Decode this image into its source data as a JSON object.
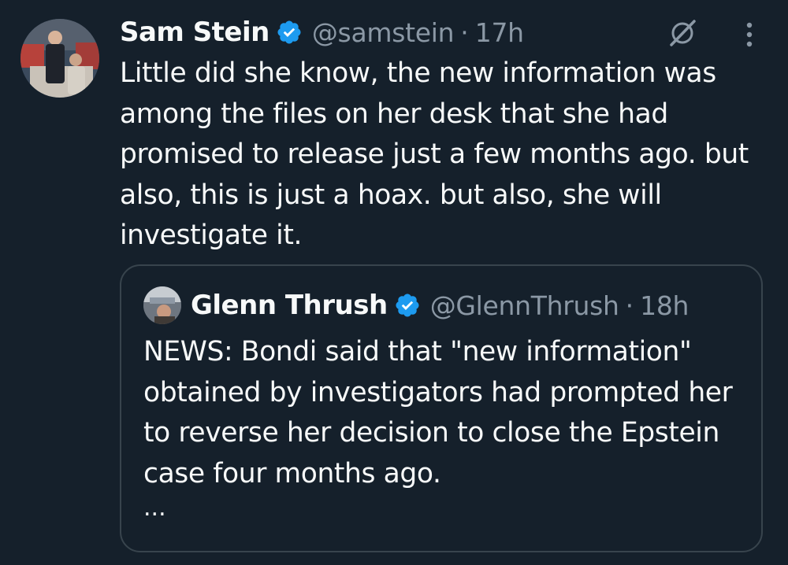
{
  "tweet": {
    "author": {
      "name": "Sam Stein",
      "handle": "@samstein",
      "time": "17h",
      "verified": true
    },
    "text": "Little did she know, the new information was among the files on her desk that she had promised to release just a few months ago. but also, this is just a hoax. but also, she will investigate it."
  },
  "quote": {
    "author": {
      "name": "Glenn Thrush",
      "handle": "@GlennThrush",
      "time": "18h",
      "verified": true
    },
    "text": "NEWS: Bondi said that \"new information\" obtained by investigators had prompted her to reverse her decision to close the Epstein case four months ago.",
    "truncation": "..."
  },
  "separator": "·",
  "colors": {
    "background": "#15202b",
    "text": "#f7f9f9",
    "secondary_text": "#8b98a5",
    "verified_badge": "#1d9bf0",
    "border": "#38444d"
  },
  "icons": {
    "verified": "verified-badge-icon",
    "grok": "grok-icon",
    "more": "more-options-icon"
  }
}
